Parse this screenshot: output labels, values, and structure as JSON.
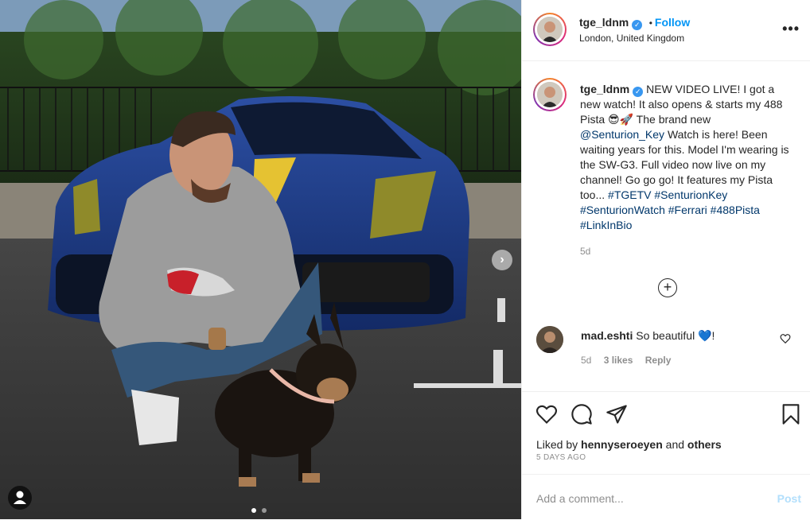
{
  "header": {
    "username": "tge_ldnm",
    "separator": "•",
    "follow_label": "Follow",
    "location": "London, United Kingdom",
    "more_icon": "more-options-icon"
  },
  "caption": {
    "username": "tge_ldnm",
    "text_1": "NEW VIDEO LIVE! I got a new watch! It also opens & starts my 488 Pista 😎🚀 The brand new",
    "mention": "@Senturion_Key",
    "text_2": "Watch is here! Been waiting years for this. Model I'm wearing is the SW-G3. Full video now live on my channel! Go go go! It features my Pista too...",
    "hashtags": [
      "#TGETV",
      "#SenturionKey",
      "#SenturionWatch",
      "#Ferrari",
      "#488Pista",
      "#LinkInBio"
    ],
    "timestamp": "5d"
  },
  "comment": {
    "username": "mad.eshti",
    "text": "So beautiful 💙!",
    "timestamp": "5d",
    "likes": "3 likes",
    "reply": "Reply"
  },
  "likes": {
    "prefix": "Liked by",
    "user": "hennyseroeyen",
    "and": "and",
    "others": "others"
  },
  "posted": "5 DAYS AGO",
  "add_comment": {
    "placeholder": "Add a comment...",
    "post": "Post"
  },
  "colors": {
    "accent": "#0095f6",
    "verified": "#3897f0",
    "car": "#1f3e8a",
    "stripe": "#e5c232"
  }
}
